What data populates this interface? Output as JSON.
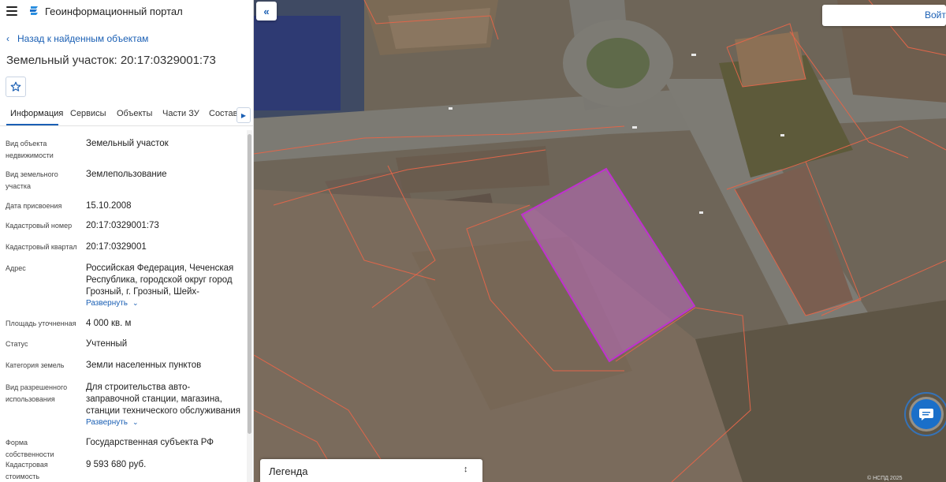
{
  "header": {
    "title": "Геоинформационный портал"
  },
  "nav": {
    "back_label": "Назад к найденным объектам"
  },
  "object": {
    "title": "Земельный участок: 20:17:0329001:73"
  },
  "tabs": [
    {
      "label": "Информация"
    },
    {
      "label": "Сервисы"
    },
    {
      "label": "Объекты"
    },
    {
      "label": "Части ЗУ"
    },
    {
      "label": "Состав"
    }
  ],
  "expand_label": "Развернуть",
  "fields": [
    {
      "label": "Вид объекта недвижимости",
      "value": "Земельный участок"
    },
    {
      "label": "Вид земельного участка",
      "value": "Землепользование"
    },
    {
      "label": "Дата присвоения",
      "value": "15.10.2008"
    },
    {
      "label": "Кадастровый номер",
      "value": "20:17:0329001:73"
    },
    {
      "label": "Кадастровый квартал",
      "value": "20:17:0329001"
    },
    {
      "label": "Адрес",
      "value": "Российская Федерация, Чеченская Республика, городской округ город Грозный, г. Грозный, Шейх-"
    },
    {
      "label": "Площадь уточненная",
      "value": "4 000 кв. м"
    },
    {
      "label": "Статус",
      "value": "Учтенный"
    },
    {
      "label": "Категория земель",
      "value": "Земли населенных пунктов"
    },
    {
      "label": "Вид разрешенного использования",
      "value": "Для строительства авто-заправочной станции, магазина, станции технического обслуживания"
    },
    {
      "label": "Форма собственности",
      "value": "Государственная субъекта РФ"
    },
    {
      "label": "Кадастровая стоимость",
      "value": "9 593 680 руб."
    }
  ],
  "map": {
    "login_label": "Войти",
    "legend_label": "Легенда",
    "copyright": "© НСПД 2025"
  },
  "colors": {
    "accent": "#1a5fb4",
    "parcel_highlight": "#b040c0",
    "parcel_border": "#e0664a"
  },
  "icons": [
    "menu-icon",
    "portal-logo-icon",
    "chevron-left-icon",
    "star-icon",
    "chevron-right-icon",
    "double-chevron-left-icon",
    "chevron-down-icon",
    "sort-arrows-icon",
    "chat-icon"
  ]
}
